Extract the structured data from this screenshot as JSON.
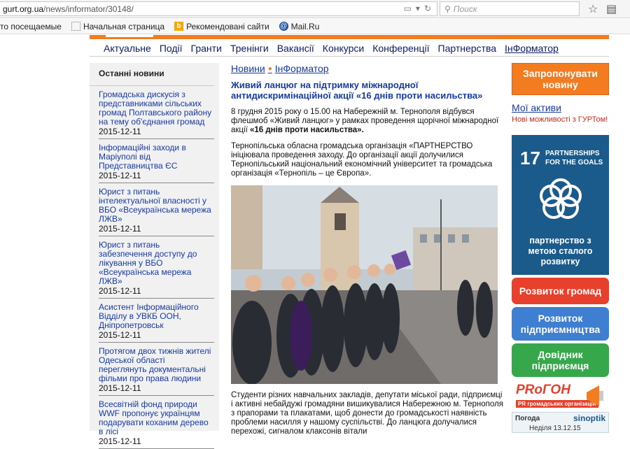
{
  "browser": {
    "url_host": "gurt.org.ua",
    "url_path": "/news/informator/30148/",
    "search_placeholder": "Поиск"
  },
  "bookmarks": [
    {
      "label": "то посещаемые",
      "icon": "none"
    },
    {
      "label": "Начальная страница",
      "icon": "page-icon"
    },
    {
      "label": "Рекомендовані сайти",
      "icon": "bing-icon"
    },
    {
      "label": "Mail.Ru",
      "icon": "mailru-icon"
    }
  ],
  "nav": [
    "Актуальне",
    "Події",
    "Гранти",
    "Тренінги",
    "Вакансії",
    "Конкурси",
    "Конференції",
    "Партнерства",
    "ІнФорматор"
  ],
  "sidebar": {
    "title": "Останні новини",
    "items": [
      {
        "title": "Громадська дискусія з представниками сільських громад Полтавського району на тему об'єднання громад",
        "date": "2015-12-11"
      },
      {
        "title": "Інформаційні заходи в Маріуполі від Представництва ЄС",
        "date": "2015-12-11"
      },
      {
        "title": "Юрист з питань інтелектуальної власності у ВБО «Всеукраїнська мережа ЛЖВ»",
        "date": "2015-12-11"
      },
      {
        "title": "Юрист з питань забезпечення доступу до лікування у ВБО «Всеукраїнська мережа ЛЖВ»",
        "date": "2015-12-11"
      },
      {
        "title": "Асистент Інформаційного Відділу в УВКБ ООН, Дніпропетровськ",
        "date": "2015-12-11"
      },
      {
        "title": "Протягом двох тижнів жителі Одеської області переглянуть документальні фільми про права людини",
        "date": "2015-12-11"
      },
      {
        "title": "Всесвітній фонд природи WWF пропонує українцям подарувати коханим дерево в лісі",
        "date": "2015-12-11"
      }
    ]
  },
  "main": {
    "crumb1": "Новини",
    "crumb2": "ІнФорматор",
    "headline": "Живий ланцюг на підтримку міжнародної антидискримінаційної акції «16 днів проти насильства»",
    "p1_a": "8 грудня 2015 року о 15.00 на Набережній м. Тернополя  відбувся флешмоб «Живий ланцюг» у рамках проведення щорічної міжнародної акції ",
    "p1_b": "«16 днів проти насильства».",
    "p2": "Тернопільська обласна громадська організація «ПАРТНЕРСТВО ініціювала проведення заходу. До організації акції долучилися Тернопільський національний економічний університет та громадська організація «Тернопіль – це Європа».",
    "p3": "Студенти  різних навчальних закладів, депутати міської ради, підприємці і активні небайдужі громадяни вишикувалися Набережною м. Тернополя з прапорами та плакатами, щоб донести до громадськості наявність проблеми насилля у нашому суспільстві. До ланцюга долучалися перехожі, сигналом клаксонів вітали"
  },
  "right": {
    "propose_btn": "Запропонувати новину",
    "my_assets": "Мої активи",
    "new_opps": "Нові можливості з ГУРТом!",
    "sdg_number": "17",
    "sdg_title_line1": "PARTNERSHIPS",
    "sdg_title_line2": "FOR THE GOALS",
    "sdg_caption": "партнерство з метою сталого розвитку",
    "btn_communities": "Розвиток громад",
    "btn_business": "Розвиток підприємництва",
    "btn_directory": "Довідник підприємця",
    "progon_logo": "PRоГОН",
    "progon_sub": "PR громадських організацій",
    "weather_label": "Погода",
    "weather_brand": "sinoptik",
    "weather_date": "Неділя 13.12.15"
  },
  "colors": {
    "accent_orange": "#f27c1f",
    "link_blue": "#163aa8",
    "sdg_blue": "#1a5b8c"
  }
}
